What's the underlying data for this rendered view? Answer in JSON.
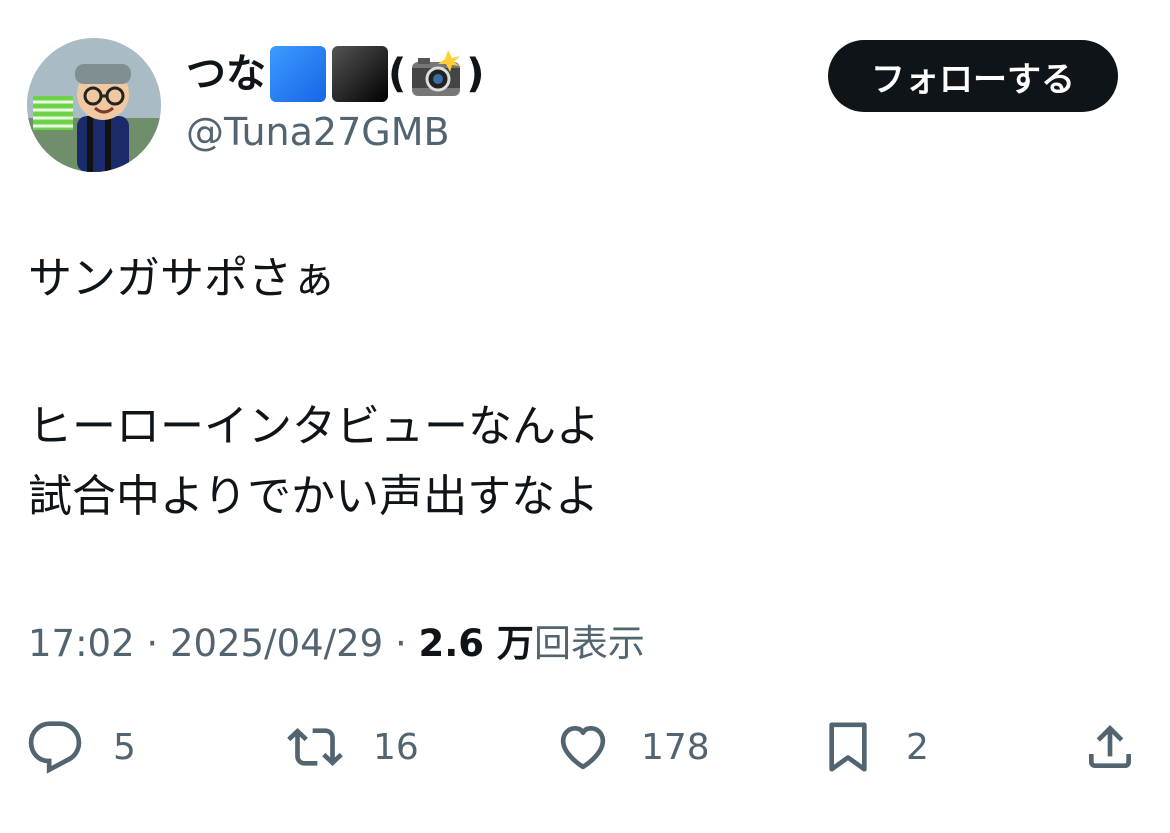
{
  "user": {
    "display_name": "つな",
    "emoji_1": "blue-square",
    "emoji_2": "black-square",
    "paren_open": "(",
    "paren_close": ")",
    "emoji_3": "camera-with-flash",
    "handle": "@Tuna27GMB"
  },
  "follow_button": {
    "label": "フォローする"
  },
  "tweet": {
    "lines": [
      "サンガサポさぁ",
      "",
      "ヒーローインタビューなんよ",
      "試合中よりでかい声出すなよ"
    ]
  },
  "meta": {
    "time": "17:02",
    "separator": " · ",
    "date": "2025/04/29",
    "views_count": "2.6 万",
    "views_label": "回表示"
  },
  "actions": {
    "reply": {
      "icon": "reply-icon",
      "count": "5"
    },
    "retweet": {
      "icon": "retweet-icon",
      "count": "16"
    },
    "like": {
      "icon": "heart-icon",
      "count": "178"
    },
    "bookmark": {
      "icon": "bookmark-icon",
      "count": "2"
    },
    "share": {
      "icon": "share-icon"
    }
  },
  "colors": {
    "text_primary": "#0f1419",
    "text_secondary": "#536471",
    "follow_bg": "#0f1419",
    "follow_text": "#ffffff"
  }
}
